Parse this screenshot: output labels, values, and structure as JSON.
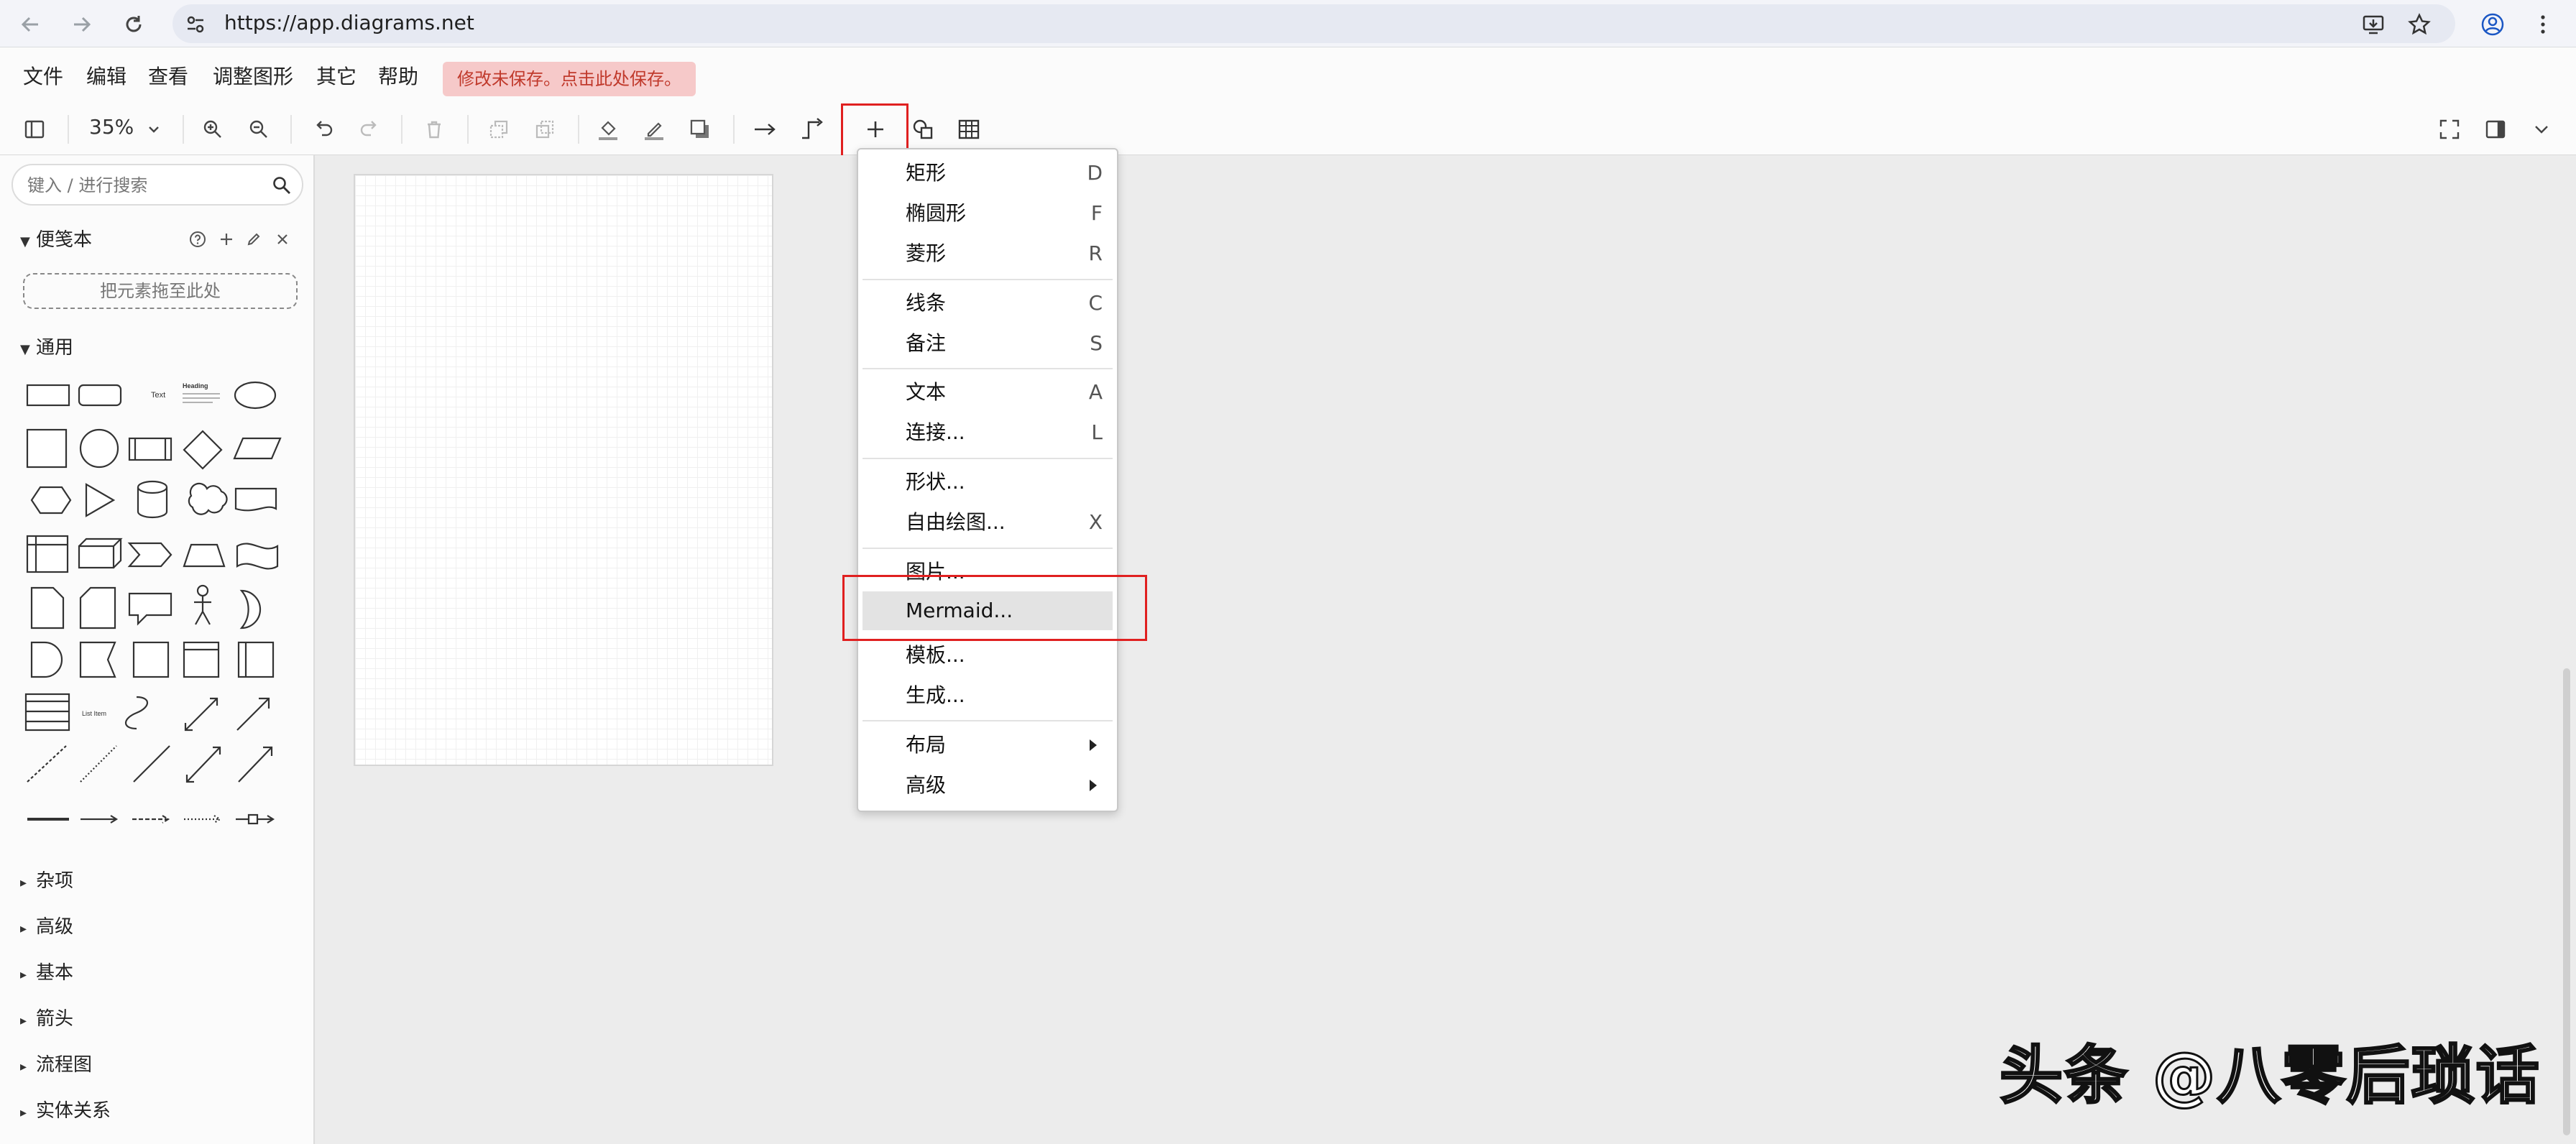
{
  "browser": {
    "url": "https://app.diagrams.net"
  },
  "menubar": {
    "items": [
      "文件",
      "编辑",
      "查看",
      "调整图形",
      "其它",
      "帮助"
    ],
    "unsaved": "修改未保存。点击此处保存。"
  },
  "toolbar": {
    "zoom": "35%"
  },
  "sidebar": {
    "search_placeholder": "键入 / 进行搜索",
    "scratchpad": {
      "title": "便笺本",
      "drop_hint": "把元素拖至此处"
    },
    "general": {
      "title": "通用",
      "text_shape": "Text",
      "heading_shape": "Heading",
      "list_item": "List Item"
    },
    "collapsed": [
      "杂项",
      "高级",
      "基本",
      "箭头",
      "流程图",
      "实体关系"
    ]
  },
  "menu": {
    "items": [
      {
        "label": "矩形",
        "shortcut": "D"
      },
      {
        "label": "椭圆形",
        "shortcut": "F"
      },
      {
        "label": "菱形",
        "shortcut": "R"
      },
      {
        "label": "线条",
        "shortcut": "C"
      },
      {
        "label": "备注",
        "shortcut": "S"
      },
      {
        "label": "文本",
        "shortcut": "A"
      },
      {
        "label": "连接...",
        "shortcut": "L"
      },
      {
        "label": "形状...",
        "shortcut": ""
      },
      {
        "label": "自由绘图...",
        "shortcut": "X"
      },
      {
        "label": "图片...",
        "shortcut": ""
      },
      {
        "label": "Mermaid...",
        "shortcut": ""
      },
      {
        "label": "模板...",
        "shortcut": ""
      },
      {
        "label": "生成...",
        "shortcut": ""
      },
      {
        "label": "布局",
        "shortcut": ""
      },
      {
        "label": "高级",
        "shortcut": ""
      }
    ]
  },
  "watermark": "头条 @八零后琐话",
  "colors": {
    "highlight_box": "#e02020",
    "unsaved_bg": "#f6c9c9",
    "unsaved_text": "#c0392b"
  }
}
